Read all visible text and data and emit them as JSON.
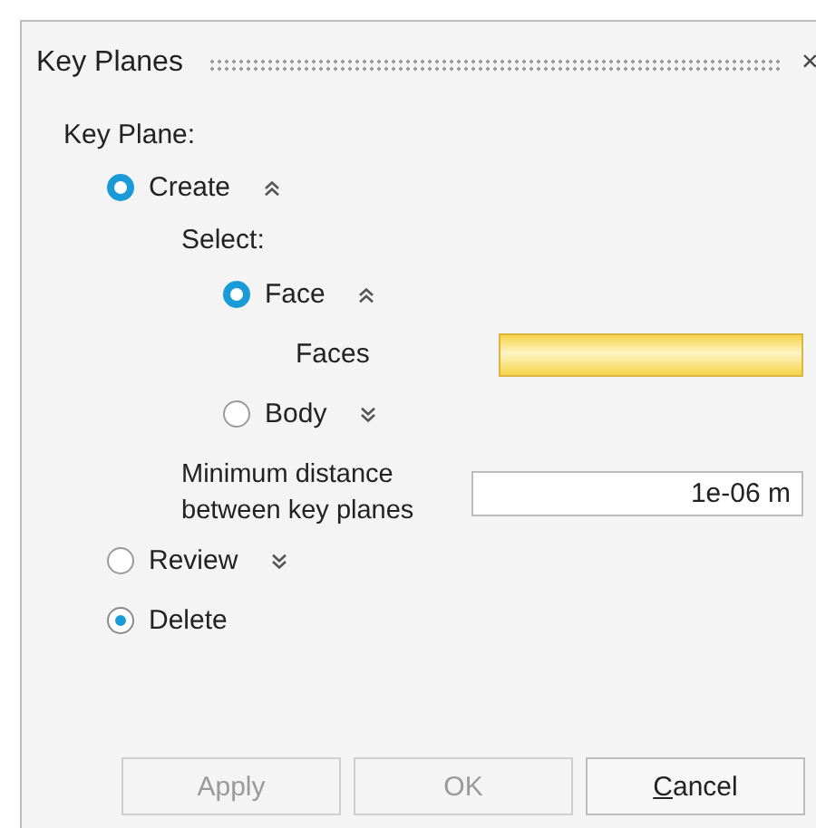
{
  "panel": {
    "title": "Key Planes",
    "close": "×"
  },
  "section_label": "Key Plane:",
  "modes": [
    {
      "label": "Create",
      "selected": true,
      "kind": "filled",
      "expanded": true
    },
    {
      "label": "Review",
      "selected": false,
      "kind": "filled",
      "expanded": false
    },
    {
      "label": "Delete",
      "selected": true,
      "kind": "dot"
    }
  ],
  "select": {
    "label": "Select:",
    "options": [
      {
        "label": "Face",
        "selected": true,
        "expanded": true,
        "field": {
          "label": "Faces",
          "active": true
        }
      },
      {
        "label": "Body",
        "selected": false,
        "expanded": false
      }
    ],
    "distance": {
      "label": "Minimum distance between key planes",
      "value": "1e-06 m"
    }
  },
  "buttons": [
    {
      "label": "Apply",
      "disabled": true,
      "mnemonic": false
    },
    {
      "label": "OK",
      "disabled": true,
      "mnemonic": false
    },
    {
      "label": "Cancel",
      "disabled": false,
      "mnemonic": true
    }
  ]
}
